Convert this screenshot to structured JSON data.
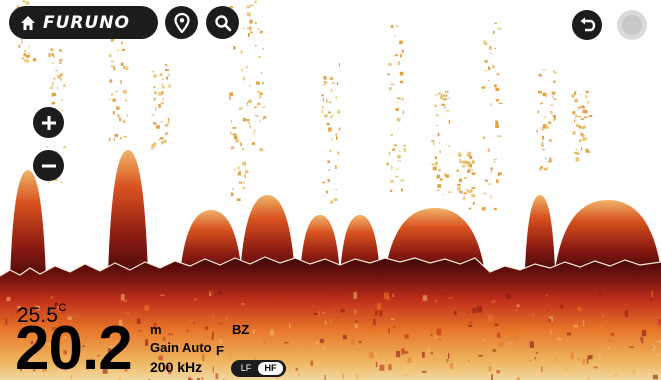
{
  "header": {
    "brand": "FURUNO"
  },
  "icons": {
    "home": "home-icon",
    "pin": "map-pin-icon",
    "search": "search-icon",
    "undo": "undo-icon",
    "record": "record-icon",
    "zoom_in": "plus-icon",
    "zoom_out": "minus-icon"
  },
  "readout": {
    "temperature": "25.5",
    "temperature_unit": "°C",
    "depth": "20.2",
    "depth_unit": "m",
    "gain": "Gain Auto",
    "frequency": "200 kHz",
    "bz": "BZ",
    "f_marker": "F"
  },
  "freq_toggle": {
    "lf_label": "LF",
    "hf_label": "HF",
    "selected": "HF"
  },
  "colors": {
    "button_bg": "#1c1c1c",
    "echo_dark": "#5a0d0d",
    "echo_red": "#c0301b",
    "echo_orange": "#e8782a",
    "echo_yellow": "#e8c46a"
  }
}
